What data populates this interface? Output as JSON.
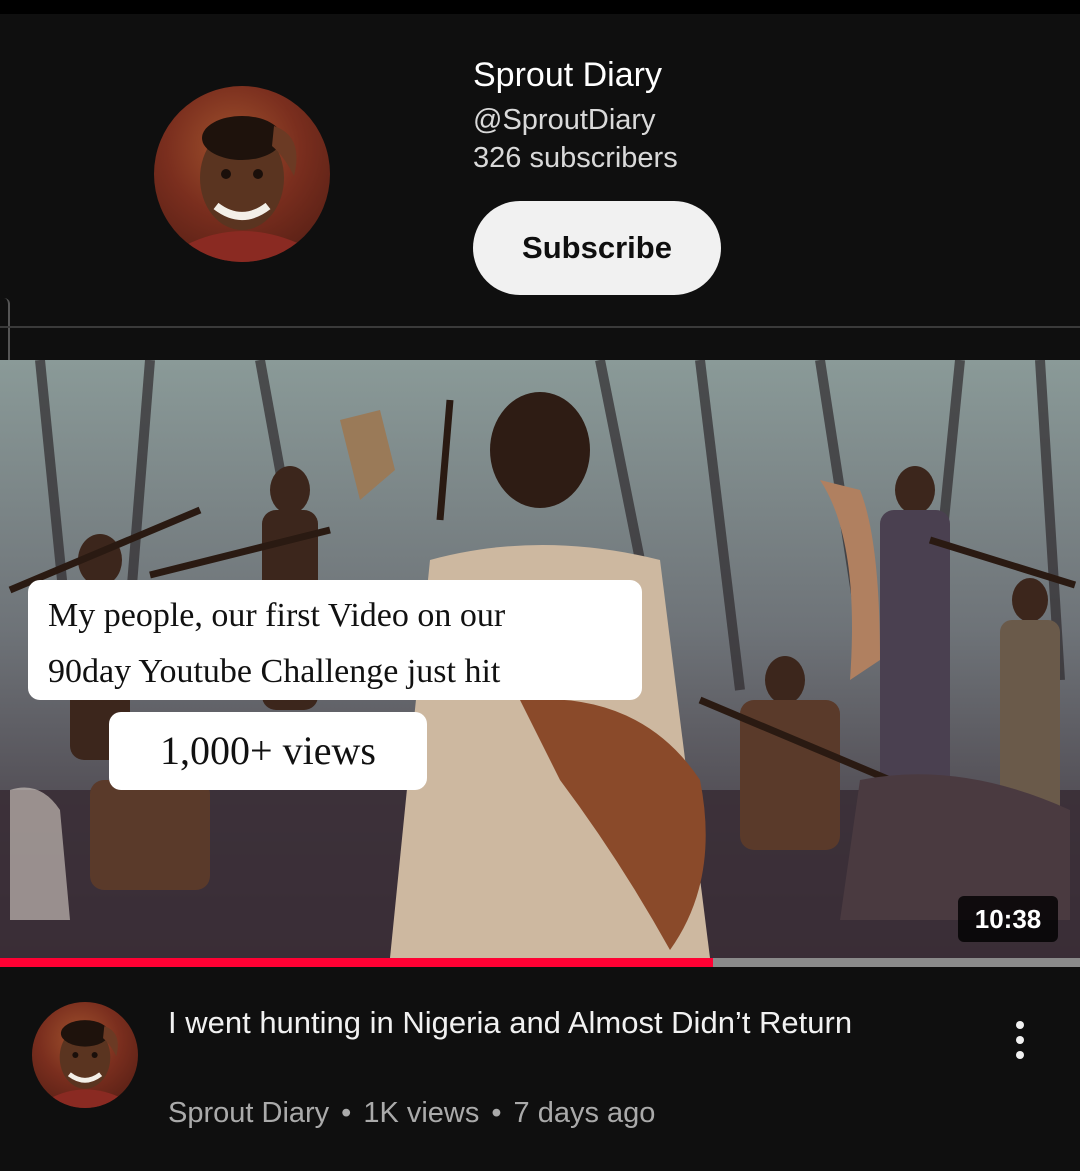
{
  "channel": {
    "name": "Sprout Diary",
    "handle": "@SproutDiary",
    "subscribers": "326 subscribers",
    "subscribe_label": "Subscribe"
  },
  "video": {
    "thumbnail_caption_line1": "My people, our first Video on our",
    "thumbnail_caption_line2": "90day Youtube Challenge just hit",
    "thumbnail_caption_views": "1,000+ views",
    "duration": "10:38",
    "watch_progress": 0.66,
    "title": "I went hunting in Nigeria and Almost Didn’t Return",
    "channel_name": "Sprout Diary",
    "separator": "•",
    "views": "1K views",
    "age": "7 days ago",
    "menu_icon": "more-vert-icon"
  },
  "colors": {
    "background": "#0f0f0f",
    "progress": "#ff0033",
    "subscribe_bg": "#f1f1f1"
  }
}
